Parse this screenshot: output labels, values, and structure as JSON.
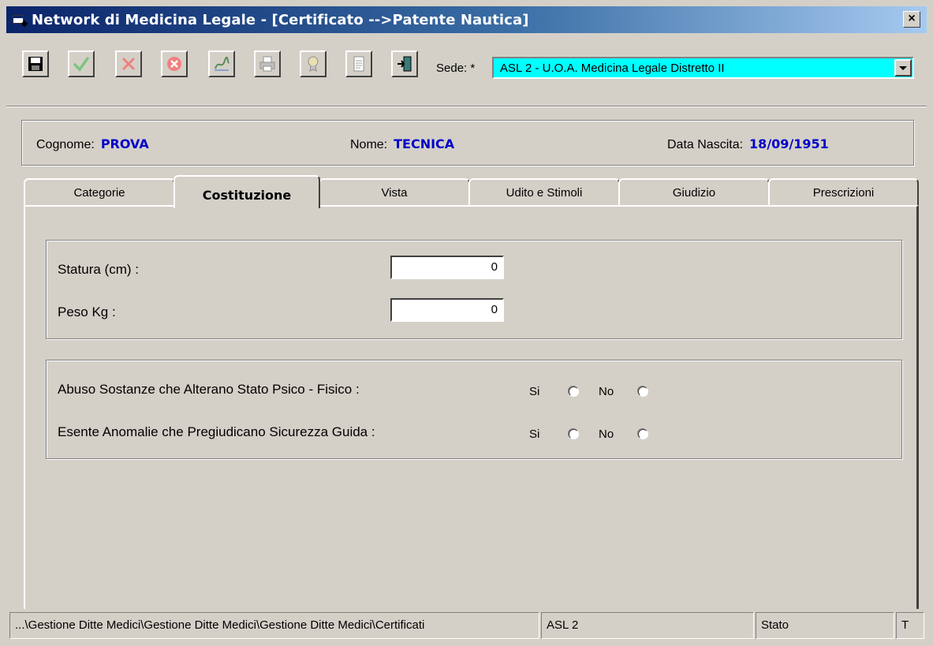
{
  "window": {
    "title": "Network di Medicina Legale - [Certificato -->Patente Nautica]",
    "close_glyph": "×"
  },
  "toolbar": {
    "buttons": [
      "save-icon",
      "confirm-check-icon",
      "cancel-x-icon",
      "delete-circle-icon",
      "sign-icon",
      "print-icon",
      "certificate-icon",
      "document-icon",
      "exit-door-icon"
    ],
    "sede_label": "Sede: *",
    "sede_value": "ASL 2 - U.O.A. Medicina Legale Distretto II",
    "sede_bg_color": "#00ffff"
  },
  "patient": {
    "cognome_label": "Cognome:",
    "cognome_value": "PROVA",
    "nome_label": "Nome:",
    "nome_value": "TECNICA",
    "nascita_label": "Data Nascita:",
    "nascita_value": "18/09/1951",
    "value_color": "#0000c8"
  },
  "tabs": [
    "Categorie",
    "Costituzione",
    "Vista",
    "Udito e Stimoli",
    "Giudizio",
    "Prescrizioni"
  ],
  "active_tab": "Costituzione",
  "costituzione": {
    "statura_label": "Statura (cm) :",
    "statura_value": "0",
    "peso_label": "Peso Kg :",
    "peso_value": "0",
    "abuso_label": "Abuso Sostanze che Alterano Stato Psico - Fisico :",
    "esente_label": "Esente Anomalie che Pregiudicano Sicurezza Guida :",
    "si_label": "Si",
    "no_label": "No"
  },
  "statusbar": {
    "path": "...\\Gestione Ditte Medici\\Gestione Ditte Medici\\Gestione Ditte Medici\\Certificati",
    "asl": "ASL 2",
    "stato": "Stato",
    "mode": "T"
  }
}
